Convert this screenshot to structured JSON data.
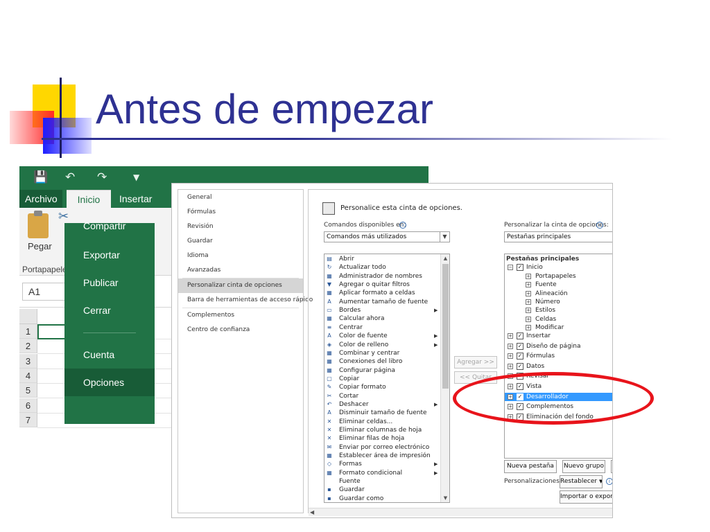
{
  "slide": {
    "title": "Antes de empezar"
  },
  "excel": {
    "tabs": {
      "file": "Archivo",
      "home": "Inicio",
      "insert": "Insertar"
    },
    "ribbon": {
      "paste_label": "Pegar",
      "clipboard_group": "Portapapeles"
    },
    "name_box": "A1",
    "row_numbers": [
      "1",
      "2",
      "3",
      "4",
      "5",
      "6",
      "7"
    ]
  },
  "backstage": {
    "items": [
      {
        "label": "Compartir",
        "selected": false
      },
      {
        "label": "Exportar",
        "selected": false
      },
      {
        "label": "Publicar",
        "selected": false
      },
      {
        "label": "Cerrar",
        "selected": false
      },
      {
        "label": "Cuenta",
        "selected": false
      },
      {
        "label": "Opciones",
        "selected": true
      }
    ]
  },
  "options_dialog": {
    "nav": [
      "General",
      "Fórmulas",
      "Revisión",
      "Guardar",
      "Idioma",
      "Avanzadas",
      "Personalizar cinta de opciones",
      "Barra de herramientas de acceso rápido",
      "Complementos",
      "Centro de confianza"
    ],
    "nav_selected_index": 6,
    "heading": "Personalice esta cinta de opciones.",
    "commands_label": "Comandos disponibles en:",
    "commands_value": "Comandos más utilizados",
    "ribbon_label": "Personalizar la cinta de opciones:",
    "ribbon_value": "Pestañas principales",
    "commands": [
      {
        "label": "Abrir",
        "arrow": false
      },
      {
        "label": "Actualizar todo",
        "arrow": false
      },
      {
        "label": "Administrador de nombres",
        "arrow": false
      },
      {
        "label": "Agregar o quitar filtros",
        "arrow": false
      },
      {
        "label": "Aplicar formato a celdas",
        "arrow": false
      },
      {
        "label": "Aumentar tamaño de fuente",
        "arrow": false
      },
      {
        "label": "Bordes",
        "arrow": true
      },
      {
        "label": "Calcular ahora",
        "arrow": false
      },
      {
        "label": "Centrar",
        "arrow": false
      },
      {
        "label": "Color de fuente",
        "arrow": true
      },
      {
        "label": "Color de relleno",
        "arrow": true
      },
      {
        "label": "Combinar y centrar",
        "arrow": false
      },
      {
        "label": "Conexiones del libro",
        "arrow": false
      },
      {
        "label": "Configurar página",
        "arrow": false
      },
      {
        "label": "Copiar",
        "arrow": false
      },
      {
        "label": "Copiar formato",
        "arrow": false
      },
      {
        "label": "Cortar",
        "arrow": false
      },
      {
        "label": "Deshacer",
        "arrow": true
      },
      {
        "label": "Disminuir tamaño de fuente",
        "arrow": false
      },
      {
        "label": "Eliminar celdas...",
        "arrow": false
      },
      {
        "label": "Eliminar columnas de hoja",
        "arrow": false
      },
      {
        "label": "Eliminar filas de hoja",
        "arrow": false
      },
      {
        "label": "Enviar por correo electrónico",
        "arrow": false
      },
      {
        "label": "Establecer área de impresión",
        "arrow": false
      },
      {
        "label": "Formas",
        "arrow": true
      },
      {
        "label": "Formato condicional",
        "arrow": true
      },
      {
        "label": "Fuente",
        "arrow": false
      },
      {
        "label": "Guardar",
        "arrow": false
      },
      {
        "label": "Guardar como",
        "arrow": false
      }
    ],
    "add_button": "Agregar >>",
    "remove_button": "<< Quitar",
    "tree": [
      {
        "label": "Pestañas principales",
        "level": 0,
        "expander": "",
        "checked": false,
        "header": true,
        "highlight": false
      },
      {
        "label": "Inicio",
        "level": 1,
        "expander": "−",
        "checked": true,
        "header": false,
        "highlight": false
      },
      {
        "label": "Portapapeles",
        "level": 2,
        "expander": "+",
        "checked": false,
        "header": false,
        "highlight": false
      },
      {
        "label": "Fuente",
        "level": 2,
        "expander": "+",
        "checked": false,
        "header": false,
        "highlight": false
      },
      {
        "label": "Alineación",
        "level": 2,
        "expander": "+",
        "checked": false,
        "header": false,
        "highlight": false
      },
      {
        "label": "Número",
        "level": 2,
        "expander": "+",
        "checked": false,
        "header": false,
        "highlight": false
      },
      {
        "label": "Estilos",
        "level": 2,
        "expander": "+",
        "checked": false,
        "header": false,
        "highlight": false
      },
      {
        "label": "Celdas",
        "level": 2,
        "expander": "+",
        "checked": false,
        "header": false,
        "highlight": false
      },
      {
        "label": "Modificar",
        "level": 2,
        "expander": "+",
        "checked": false,
        "header": false,
        "highlight": false
      },
      {
        "label": "Insertar",
        "level": 1,
        "expander": "+",
        "checked": true,
        "header": false,
        "highlight": false
      },
      {
        "label": "Diseño de página",
        "level": 1,
        "expander": "+",
        "checked": true,
        "header": false,
        "highlight": false
      },
      {
        "label": "Fórmulas",
        "level": 1,
        "expander": "+",
        "checked": true,
        "header": false,
        "highlight": false
      },
      {
        "label": "Datos",
        "level": 1,
        "expander": "+",
        "checked": true,
        "header": false,
        "highlight": false
      },
      {
        "label": "Revisar",
        "level": 1,
        "expander": "+",
        "checked": true,
        "header": false,
        "highlight": false
      },
      {
        "label": "Vista",
        "level": 1,
        "expander": "+",
        "checked": true,
        "header": false,
        "highlight": false
      },
      {
        "label": "Desarrollador",
        "level": 1,
        "expander": "+",
        "checked": true,
        "header": false,
        "highlight": true
      },
      {
        "label": "Complementos",
        "level": 1,
        "expander": "+",
        "checked": true,
        "header": false,
        "highlight": false
      },
      {
        "label": "Eliminación del fondo",
        "level": 1,
        "expander": "+",
        "checked": true,
        "header": false,
        "highlight": false
      }
    ],
    "new_tab_button": "Nueva pestaña",
    "new_group_button": "Nuevo grupo",
    "customizations_label": "Personalizaciones:",
    "reset_button": "Restablecer",
    "import_export_button": "Importar o exportar"
  },
  "colors": {
    "excel_green": "#217346",
    "excel_dark_green": "#185c37",
    "title_blue": "#2e3192",
    "highlight_blue": "#3399ff",
    "annotation_red": "#e8141b"
  }
}
